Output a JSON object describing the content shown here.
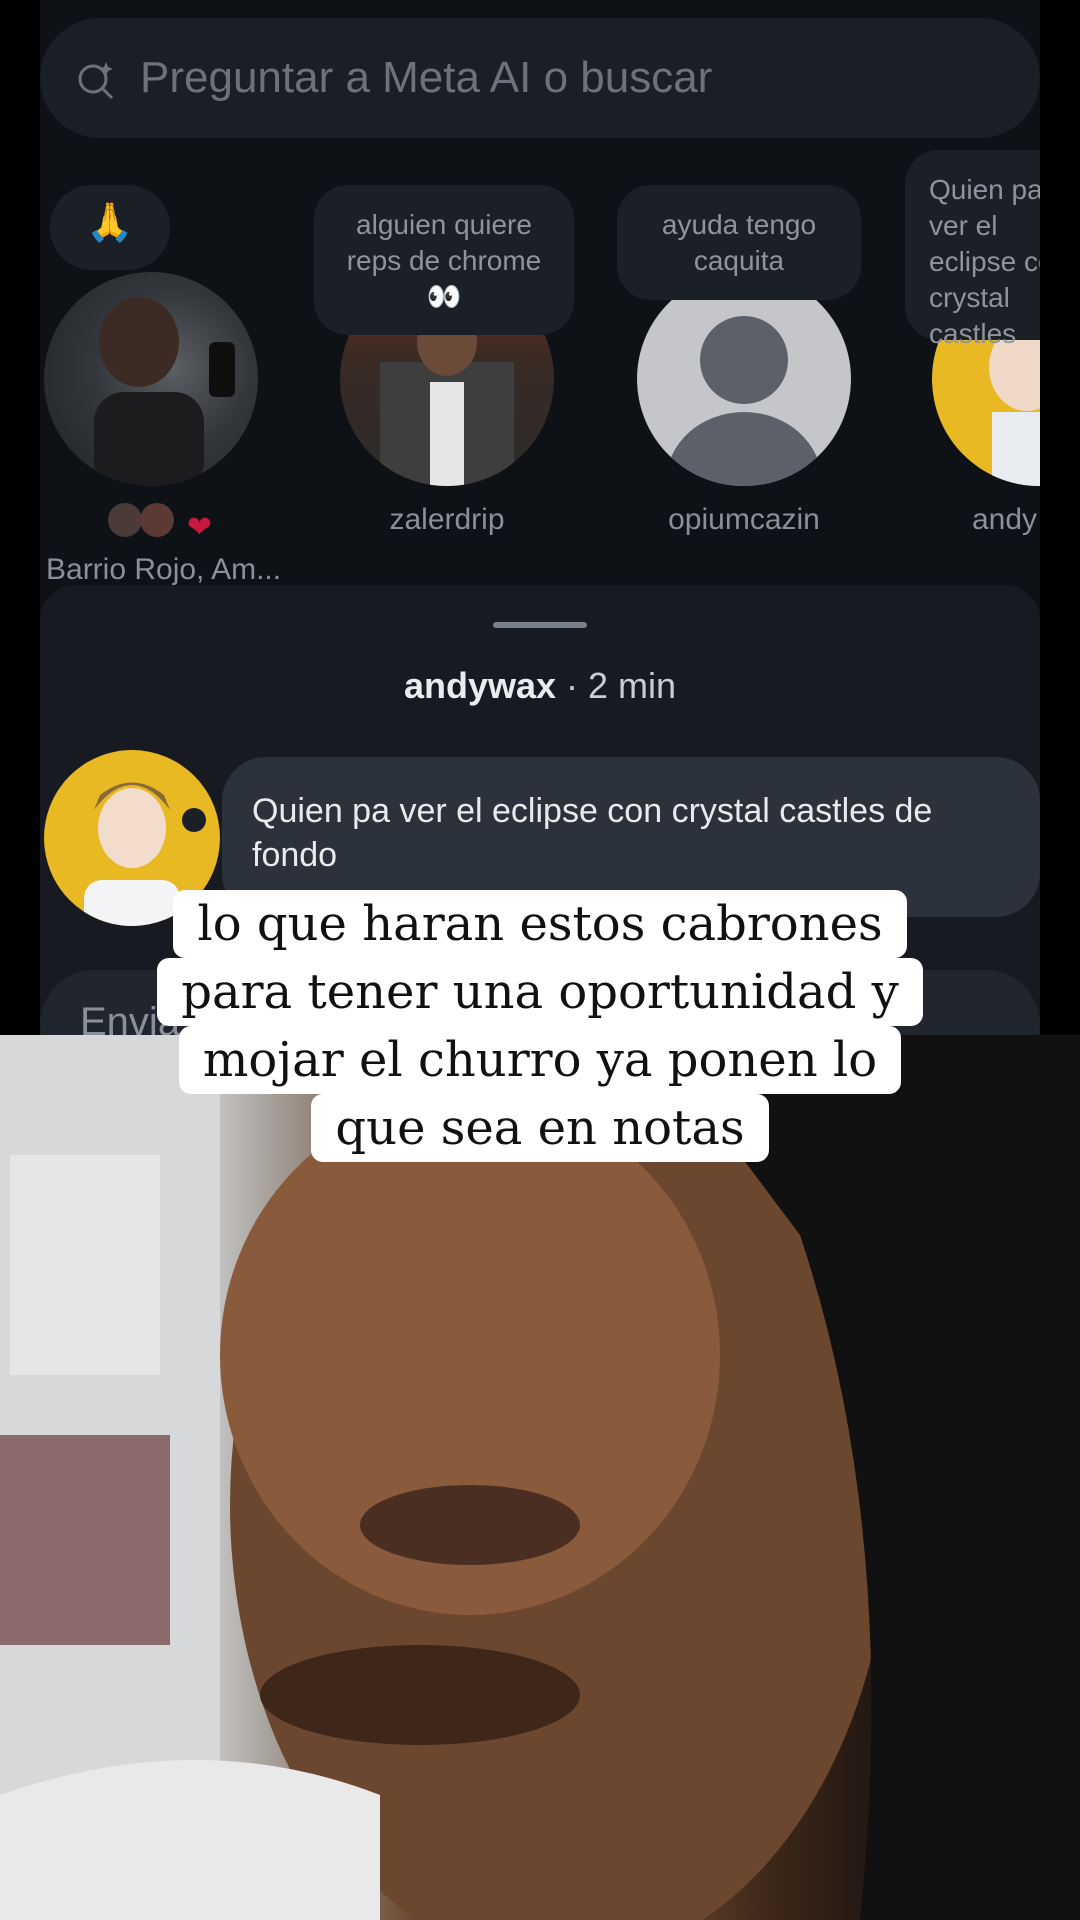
{
  "search": {
    "placeholder": "Preguntar a Meta AI o buscar"
  },
  "notes": [
    {
      "bubble": "🙏",
      "name_a": "Barrio Rojo, Am...",
      "reactions": "❤"
    },
    {
      "bubble": "alguien quiere reps de chrome 👀",
      "name": "zalerdrip"
    },
    {
      "bubble": "ayuda tengo caquita",
      "name": "opiumcazin"
    },
    {
      "bubble": "Quien pa ver el eclipse con crystal castles",
      "name": "andy"
    }
  ],
  "sheet": {
    "user": "andywax",
    "time": " · 2 min",
    "message": "Quien pa ver el eclipse con crystal castles de fondo",
    "reply_placeholder": "Envia"
  },
  "caption": {
    "lines": [
      "lo que haran estos cabrones",
      "para tener una oportunidad y",
      "mojar el churro ya ponen lo",
      "que sea en notas"
    ]
  },
  "colors": {
    "bg": "#0e1116",
    "bubble": "#1b2027",
    "message": "#2c323b",
    "accent_heart": "#e0245e"
  }
}
